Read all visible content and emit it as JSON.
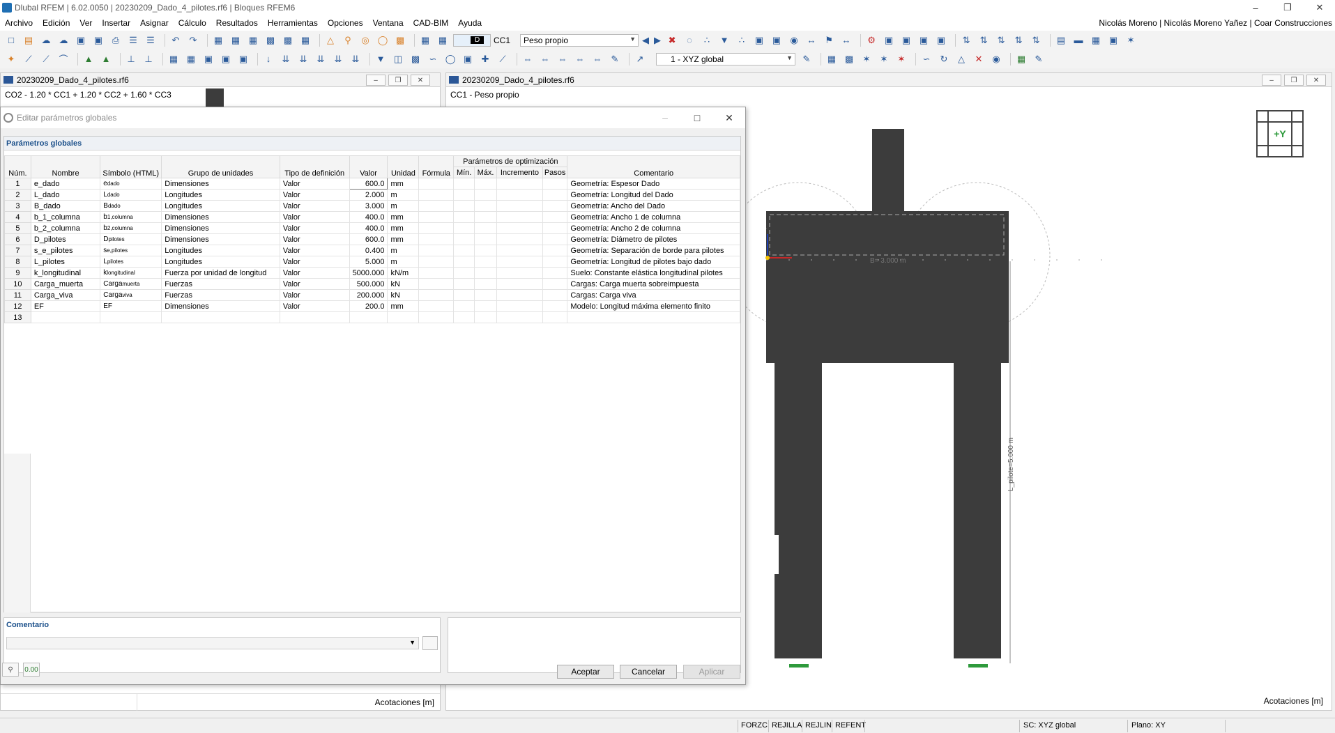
{
  "window": {
    "title": "Dlubal RFEM | 6.02.0050 | 20230209_Dado_4_pilotes.rf6 | Bloques RFEM6"
  },
  "menu": {
    "items": [
      "Archivo",
      "Edición",
      "Ver",
      "Insertar",
      "Asignar",
      "Cálculo",
      "Resultados",
      "Herramientas",
      "Opciones",
      "Ventana",
      "CAD-BIM",
      "Ayuda"
    ],
    "user": "Nicolás Moreno | Nicolás Moreno Yañez | Coar Construcciones"
  },
  "toolbar": {
    "load_case_badge": "D",
    "load_case_code": "CC1",
    "load_case_name": "Peso propio",
    "coord_system": "1 - XYZ global"
  },
  "left_pane": {
    "file": "20230209_Dado_4_pilotes.rf6",
    "combination": "CO2 - 1.20 * CC1 + 1.20 * CC2 + 1.60 * CC3",
    "footer": "Acotaciones [m]"
  },
  "right_pane": {
    "file": "20230209_Dado_4_pilotes.rf6",
    "load_case": "CC1 - Peso propio",
    "footer": "Acotaciones [m]",
    "dim_top": "B= 3.000 m",
    "dim_pile": "L_pilote=5.000 m",
    "navcube_label": "+Y",
    "axis_z": "Z"
  },
  "dialog": {
    "title": "Editar parámetros globales",
    "section": "Parámetros globales",
    "headers": {
      "num": "Núm.",
      "name": "Nombre",
      "symbol": "Símbolo (HTML)",
      "unit_group": "Grupo de unidades",
      "def_type": "Tipo de definición",
      "value": "Valor",
      "unit": "Unidad",
      "formula": "Fórmula",
      "opt_group": "Parámetros de optimización",
      "min": "Mín.",
      "max": "Máx.",
      "increment": "Incremento",
      "steps": "Pasos",
      "comment": "Comentario"
    },
    "rows": [
      {
        "num": "1",
        "name": "e_dado",
        "sym": "e",
        "sub": "dado",
        "group": "Dimensiones",
        "type": "Valor",
        "value": "600.0",
        "unit": "mm",
        "comment": "Geometría: Espesor Dado"
      },
      {
        "num": "2",
        "name": "L_dado",
        "sym": "L",
        "sub": "dado",
        "group": "Longitudes",
        "type": "Valor",
        "value": "2.000",
        "unit": "m",
        "comment": "Geometría: Longitud del Dado"
      },
      {
        "num": "3",
        "name": "B_dado",
        "sym": "B",
        "sub": "dado",
        "group": "Longitudes",
        "type": "Valor",
        "value": "3.000",
        "unit": "m",
        "comment": "Geometría: Ancho del Dado"
      },
      {
        "num": "4",
        "name": "b_1_columna",
        "sym": "b",
        "sub": "1,columna",
        "group": "Dimensiones",
        "type": "Valor",
        "value": "400.0",
        "unit": "mm",
        "comment": "Geometría: Ancho 1 de columna"
      },
      {
        "num": "5",
        "name": "b_2_columna",
        "sym": "b",
        "sub": "2,columna",
        "group": "Dimensiones",
        "type": "Valor",
        "value": "400.0",
        "unit": "mm",
        "comment": "Geometría: Ancho 2 de columna"
      },
      {
        "num": "6",
        "name": "D_pilotes",
        "sym": "D",
        "sub": "pilotes",
        "group": "Dimensiones",
        "type": "Valor",
        "value": "600.0",
        "unit": "mm",
        "comment": "Geometría: Diámetro de pilotes"
      },
      {
        "num": "7",
        "name": "s_e_pilotes",
        "sym": "s",
        "sub": "e,pilotes",
        "group": "Longitudes",
        "type": "Valor",
        "value": "0.400",
        "unit": "m",
        "comment": "Geometría: Separación de borde para pilotes"
      },
      {
        "num": "8",
        "name": "L_pilotes",
        "sym": "L",
        "sub": "pilotes",
        "group": "Longitudes",
        "type": "Valor",
        "value": "5.000",
        "unit": "m",
        "comment": "Geometría: Longitud de pilotes bajo dado"
      },
      {
        "num": "9",
        "name": "k_longitudinal",
        "sym": "k",
        "sub": "longitudinal",
        "group": "Fuerza por unidad de longitud",
        "type": "Valor",
        "value": "5000.000",
        "unit": "kN/m",
        "comment": "Suelo: Constante elástica longitudinal pilotes"
      },
      {
        "num": "10",
        "name": "Carga_muerta",
        "sym": "Carga",
        "sub": "muerta",
        "group": "Fuerzas",
        "type": "Valor",
        "value": "500.000",
        "unit": "kN",
        "comment": "Cargas: Carga muerta sobreimpuesta"
      },
      {
        "num": "11",
        "name": "Carga_viva",
        "sym": "Carga",
        "sub": "viva",
        "group": "Fuerzas",
        "type": "Valor",
        "value": "200.000",
        "unit": "kN",
        "comment": "Cargas: Carga viva"
      },
      {
        "num": "12",
        "name": "EF",
        "sym": "EF",
        "sub": "",
        "group": "Dimensiones",
        "type": "Valor",
        "value": "200.0",
        "unit": "mm",
        "comment": "Modelo: Longitud máxima elemento finito"
      },
      {
        "num": "13",
        "name": "",
        "sym": "",
        "sub": "",
        "group": "",
        "type": "",
        "value": "",
        "unit": "",
        "comment": ""
      }
    ],
    "comment_label": "Comentario",
    "bottom_value_icon": "0.00",
    "buttons": {
      "ok": "Aceptar",
      "cancel": "Cancelar",
      "apply": "Aplicar"
    }
  },
  "statusbar": {
    "forzc": "FORZC",
    "rejilla": "REJILLA",
    "rejlin": "REJLIN",
    "refent": "REFENT",
    "sc": "SC: XYZ global",
    "plano": "Plano: XY"
  },
  "colors": {
    "accent": "#1a4f8a",
    "model_solid": "#3c3c3c",
    "navcube_green": "#2e9a3c"
  }
}
